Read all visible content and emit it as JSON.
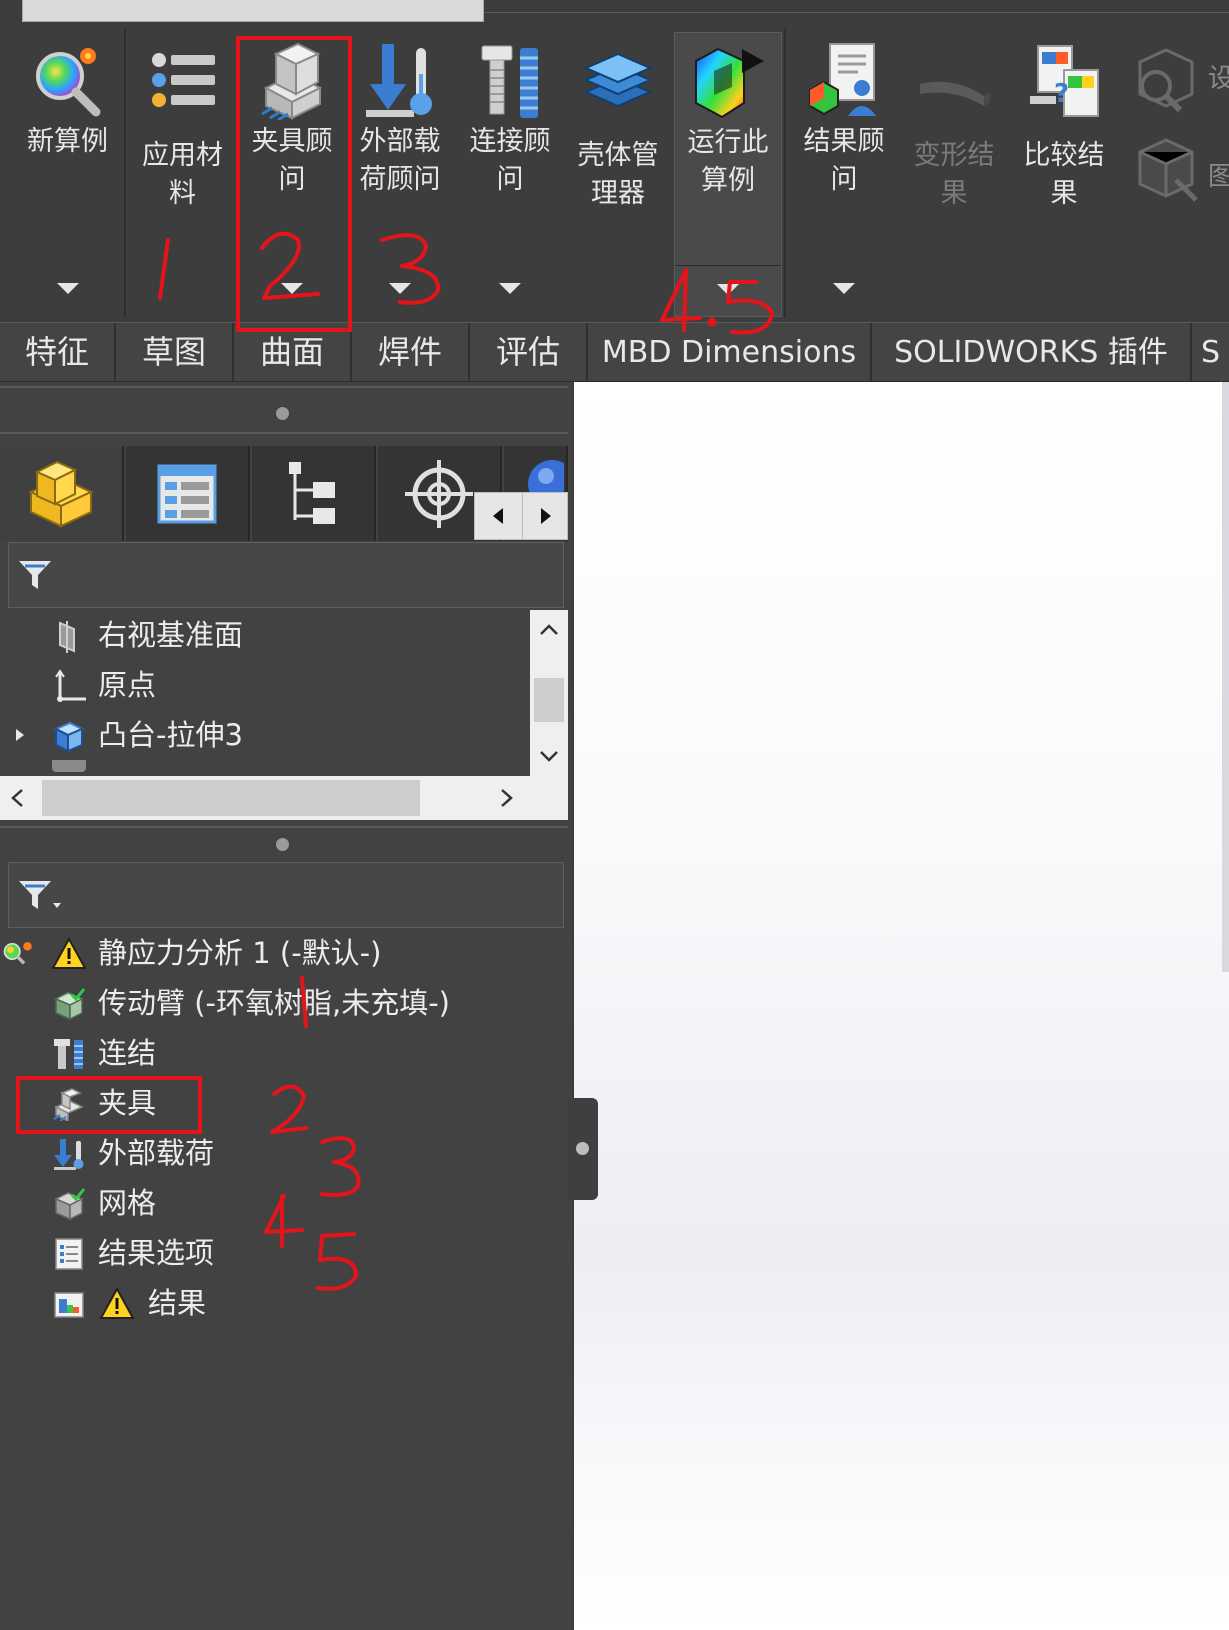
{
  "ribbon": {
    "buttons": [
      {
        "id": "new-study",
        "label_l1": "新算例",
        "label_l2": "",
        "label_l3": "",
        "icon": "magnifier-color-icon",
        "has_dropdown": true
      },
      {
        "id": "apply-material",
        "label_l1": "应用材",
        "label_l2": "料",
        "label_l3": "",
        "icon": "material-list-icon",
        "has_dropdown": false
      },
      {
        "id": "fixtures-advisor",
        "label_l1": "夹具顾",
        "label_l2": "问",
        "label_l3": "",
        "icon": "fixture-block-icon",
        "has_dropdown": true
      },
      {
        "id": "external-loads-advisor",
        "label_l1": "外部载",
        "label_l2": "荷顾问",
        "label_l3": "",
        "icon": "load-arrow-thermometer-icon",
        "has_dropdown": true
      },
      {
        "id": "connections-advisor",
        "label_l1": "连接顾",
        "label_l2": "问",
        "label_l3": "",
        "icon": "bolt-spring-icon",
        "has_dropdown": true
      },
      {
        "id": "shell-manager",
        "label_l1": "壳体管",
        "label_l2": "理器",
        "label_l3": "",
        "icon": "stacked-plates-icon",
        "has_dropdown": false
      },
      {
        "id": "run-study",
        "label_l1": "运行此",
        "label_l2": "算例",
        "label_l3": "",
        "icon": "run-colored-part-icon",
        "has_dropdown": true
      },
      {
        "id": "results-advisor",
        "label_l1": "结果顾",
        "label_l2": "问",
        "label_l3": "",
        "icon": "results-person-icon",
        "has_dropdown": true
      },
      {
        "id": "deformed-result",
        "label_l1": "变形结",
        "label_l2": "果",
        "label_l3": "",
        "icon": "deformed-beam-icon",
        "has_dropdown": false,
        "disabled": true
      },
      {
        "id": "compare-results",
        "label_l1": "比较结",
        "label_l2": "果",
        "label_l3": "",
        "icon": "compare-docs-icon",
        "has_dropdown": false
      }
    ],
    "partial_labels": [
      "设",
      "图"
    ]
  },
  "tabs": [
    "特征",
    "草图",
    "曲面",
    "焊件",
    "评估",
    "MBD Dimensions",
    "SOLIDWORKS 插件",
    "S"
  ],
  "feature_tree": {
    "items": [
      {
        "label": "右视基准面",
        "icon": "plane-icon",
        "expandable": false
      },
      {
        "label": "原点",
        "icon": "origin-icon",
        "expandable": false
      },
      {
        "label": "凸台-拉伸3",
        "icon": "extrude-boss-icon",
        "expandable": true
      }
    ]
  },
  "sim_tree": {
    "study": "静应力分析 1 (-默认-)",
    "items": [
      {
        "label": "传动臂 (-环氧树脂,未充填-)",
        "icon": "part-mesh-check-icon"
      },
      {
        "label": "连结",
        "icon": "connections-icon"
      },
      {
        "label": "夹具",
        "icon": "fixtures-icon"
      },
      {
        "label": "外部载荷",
        "icon": "external-loads-icon"
      },
      {
        "label": "网格",
        "icon": "mesh-icon"
      },
      {
        "label": "结果选项",
        "icon": "result-options-icon"
      },
      {
        "label": "结果",
        "icon": "results-folder-icon",
        "warning": true
      }
    ]
  },
  "annotations": {
    "ribbon_numbers": [
      "1",
      "2",
      "3",
      "4.5"
    ],
    "tree_numbers": [
      "1",
      "2",
      "3",
      "4",
      "5"
    ],
    "highlight_color": "#e5141b"
  }
}
